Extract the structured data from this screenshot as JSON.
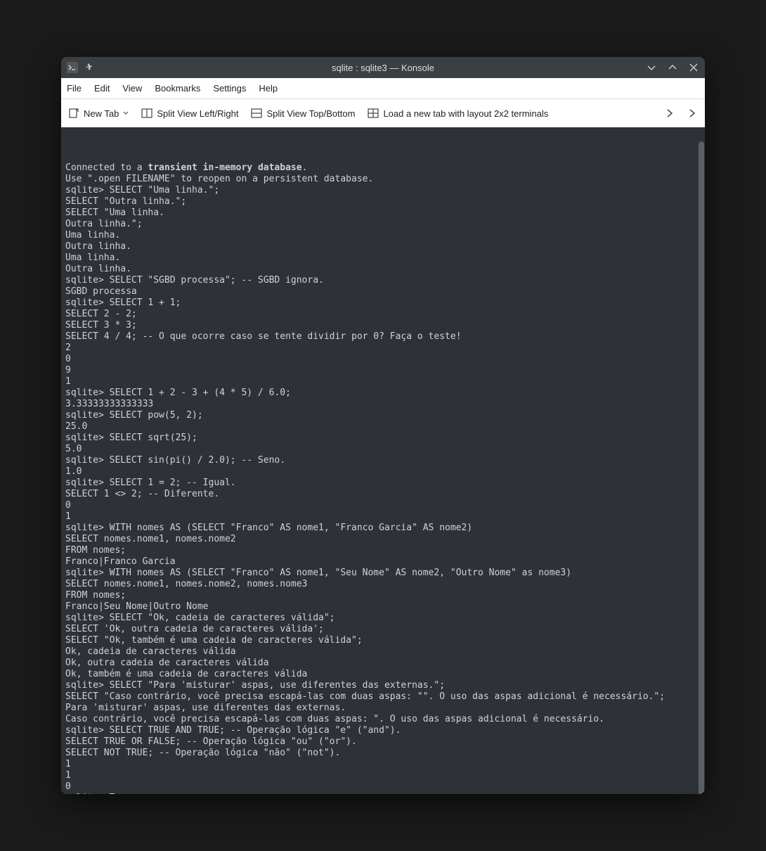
{
  "titlebar": {
    "title": "sqlite : sqlite3 — Konsole"
  },
  "menubar": {
    "file": "File",
    "edit": "Edit",
    "view": "View",
    "bookmarks": "Bookmarks",
    "settings": "Settings",
    "help": "Help"
  },
  "toolbar": {
    "new_tab": "New Tab",
    "split_lr": "Split View Left/Right",
    "split_tb": "Split View Top/Bottom",
    "load_layout": "Load a new tab with layout 2x2 terminals"
  },
  "terminal": {
    "lines": [
      {
        "t": "Connected to a ",
        "b": "transient in-memory database",
        "a": "."
      },
      {
        "t": "Use \".open FILENAME\" to reopen on a persistent database."
      },
      {
        "t": "sqlite> SELECT \"Uma linha.\";"
      },
      {
        "t": "SELECT \"Outra linha.\";"
      },
      {
        "t": "SELECT \"Uma linha."
      },
      {
        "t": "Outra linha.\";"
      },
      {
        "t": "Uma linha."
      },
      {
        "t": "Outra linha."
      },
      {
        "t": "Uma linha."
      },
      {
        "t": "Outra linha."
      },
      {
        "t": "sqlite> SELECT \"SGBD processa\"; -- SGBD ignora."
      },
      {
        "t": "SGBD processa"
      },
      {
        "t": "sqlite> SELECT 1 + 1;"
      },
      {
        "t": "SELECT 2 - 2;"
      },
      {
        "t": "SELECT 3 * 3;"
      },
      {
        "t": "SELECT 4 / 4; -- O que ocorre caso se tente dividir por 0? Faça o teste!"
      },
      {
        "t": "2"
      },
      {
        "t": "0"
      },
      {
        "t": "9"
      },
      {
        "t": "1"
      },
      {
        "t": "sqlite> SELECT 1 + 2 - 3 + (4 * 5) / 6.0;"
      },
      {
        "t": "3.33333333333333"
      },
      {
        "t": "sqlite> SELECT pow(5, 2);"
      },
      {
        "t": "25.0"
      },
      {
        "t": "sqlite> SELECT sqrt(25);"
      },
      {
        "t": "5.0"
      },
      {
        "t": "sqlite> SELECT sin(pi() / 2.0); -- Seno."
      },
      {
        "t": "1.0"
      },
      {
        "t": "sqlite> SELECT 1 = 2; -- Igual."
      },
      {
        "t": "SELECT 1 <> 2; -- Diferente."
      },
      {
        "t": "0"
      },
      {
        "t": "1"
      },
      {
        "t": "sqlite> WITH nomes AS (SELECT \"Franco\" AS nome1, \"Franco Garcia\" AS nome2)"
      },
      {
        "t": "SELECT nomes.nome1, nomes.nome2"
      },
      {
        "t": "FROM nomes;"
      },
      {
        "t": "Franco|Franco Garcia"
      },
      {
        "t": "sqlite> WITH nomes AS (SELECT \"Franco\" AS nome1, \"Seu Nome\" AS nome2, \"Outro Nome\" as nome3)"
      },
      {
        "t": "SELECT nomes.nome1, nomes.nome2, nomes.nome3"
      },
      {
        "t": "FROM nomes;"
      },
      {
        "t": "Franco|Seu Nome|Outro Nome"
      },
      {
        "t": "sqlite> SELECT \"Ok, cadeia de caracteres válida\";"
      },
      {
        "t": "SELECT 'Ok, outra cadeia de caracteres válida';"
      },
      {
        "t": "SELECT \"Ok, também é uma cadeia de caracteres válida\";"
      },
      {
        "t": "Ok, cadeia de caracteres válida"
      },
      {
        "t": "Ok, outra cadeia de caracteres válida"
      },
      {
        "t": "Ok, também é uma cadeia de caracteres válida"
      },
      {
        "t": "sqlite> SELECT \"Para 'misturar' aspas, use diferentes das externas.\";"
      },
      {
        "t": "SELECT \"Caso contrário, você precisa escapá-las com duas aspas: \"\". O uso das aspas adicional é necessário.\";"
      },
      {
        "t": "Para 'misturar' aspas, use diferentes das externas."
      },
      {
        "t": "Caso contrário, você precisa escapá-las com duas aspas: \". O uso das aspas adicional é necessário."
      },
      {
        "t": "sqlite> SELECT TRUE AND TRUE; -- Operação lógica \"e\" (\"and\")."
      },
      {
        "t": "SELECT TRUE OR FALSE; -- Operação lógica \"ou\" (\"or\")."
      },
      {
        "t": "SELECT NOT TRUE; -- Operação lógica \"não\" (\"not\")."
      },
      {
        "t": "1"
      },
      {
        "t": "1"
      },
      {
        "t": "0"
      },
      {
        "t": "sqlite> ",
        "cursor": true
      }
    ]
  }
}
